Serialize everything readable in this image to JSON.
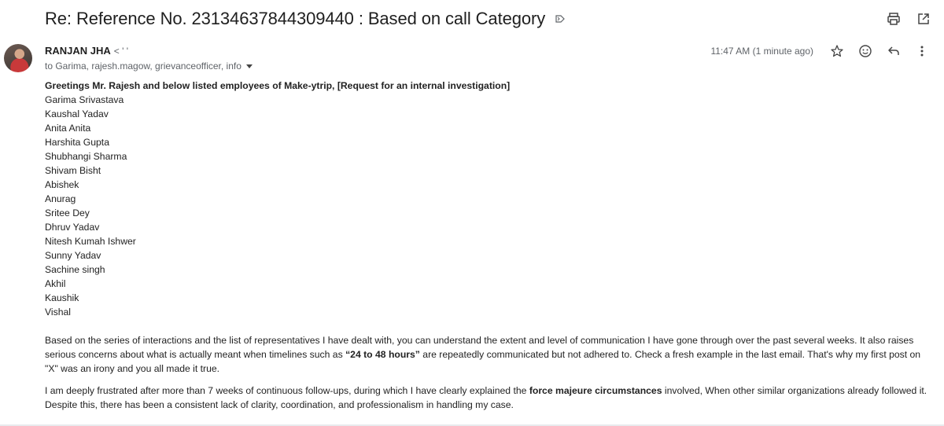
{
  "subject": "Re: Reference No. 23134637844309440 : Based on call Category",
  "icons": {
    "label": "label-arrow-icon",
    "print": "print-icon",
    "open_new": "open-in-new-window-icon",
    "star": "star-icon",
    "emoji": "emoji-reaction-icon",
    "reply": "reply-icon",
    "more": "more-vert-icon"
  },
  "sender": {
    "name": "RANJAN JHA",
    "email": "< ' '"
  },
  "recipients": "to Garima, rajesh.magow, grievanceofficer, info",
  "timestamp": "11:47 AM (1 minute ago)",
  "body": {
    "greeting": "Greetings Mr. Rajesh and below listed employees of Make-ytrip, [Request for an internal investigation]",
    "names": [
      "Garima Srivastava",
      "Kaushal Yadav",
      "Anita Anita",
      "Harshita Gupta",
      "Shubhangi Sharma",
      "Shivam Bisht",
      "Abishek",
      "Anurag",
      "Sritee Dey",
      "Dhruv Yadav",
      "Nitesh Kumah Ishwer",
      "Sunny Yadav",
      "Sachine singh",
      "Akhil",
      "Kaushik",
      "Vishal"
    ],
    "para1_part1": "Based on the series of interactions and the list of representatives I have dealt with, you can understand the extent and level of communication I have gone through over the past several weeks. It also raises serious concerns about what is actually meant when timelines such as ",
    "para1_bold": "“24 to 48 hours”",
    "para1_part2": " are repeatedly communicated but not adhered to. Check a fresh example in the last email. That's why my first post on \"X\" was an irony and you all made it true.",
    "para2_part1": "I am deeply frustrated after more than 7 weeks of continuous follow-ups, during which I have clearly explained the ",
    "para2_bold": "force majeure circumstances",
    "para2_part2": " involved, When other similar organizations already followed it. Despite this, there has been a consistent lack of clarity, coordination, and professionalism in handling my case."
  }
}
